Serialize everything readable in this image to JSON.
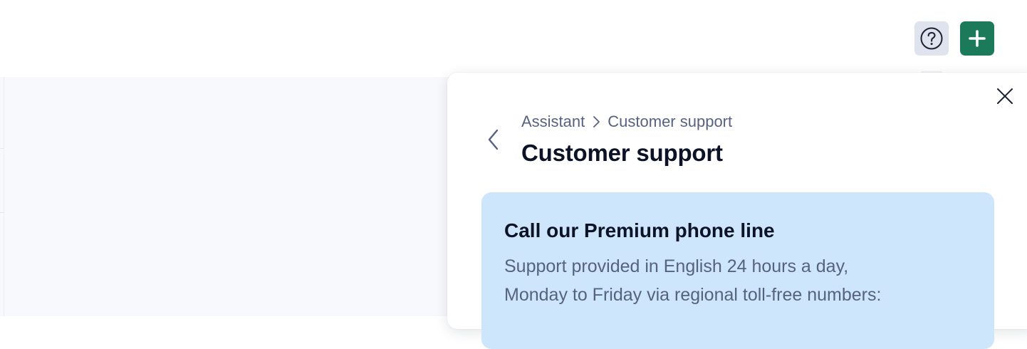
{
  "header": {
    "help_icon": "question-circle-icon",
    "add_icon": "plus-icon",
    "add_button_color": "#1a7a5a",
    "help_button_color": "#dfe3ee"
  },
  "panel": {
    "close_icon": "close-icon",
    "back_icon": "chevron-left-icon",
    "breadcrumb": {
      "root": "Assistant",
      "separator_icon": "chevron-right-icon",
      "current": "Customer support"
    },
    "title": "Customer support",
    "card": {
      "background": "#cde6fb",
      "title": "Call our Premium phone line",
      "body_line_1": "Support provided in English 24 hours a day,",
      "body_line_2": "Monday to Friday via regional toll-free numbers:"
    }
  }
}
